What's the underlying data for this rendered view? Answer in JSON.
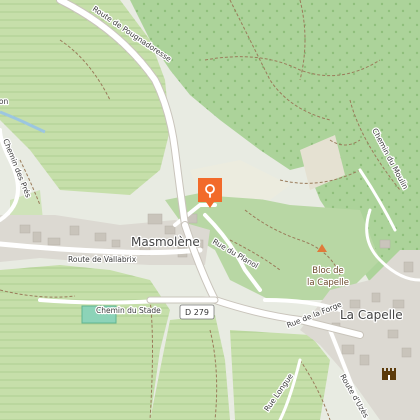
{
  "map": {
    "places": {
      "masmolene": "Masmolène",
      "la_capelle": "La Capelle"
    },
    "roads": {
      "route_pougnadoresse": "Route de Pougnadoresse",
      "route_vallabrix": "Route de Vallabrix",
      "chemin_stade": "Chemin du Stade",
      "rue_planol": "Rue du Planol",
      "rue_forge": "Rue de la Forge",
      "chemin_pres": "Chemin des Prés",
      "chemin_moulin": "Chemin du Moulin",
      "route_uzes": "Route d'Uzès",
      "rue_longue": "Rue Longue",
      "d279": "D 279",
      "partial_label": "ron"
    },
    "poi": {
      "bloc_line1": "Bloc de",
      "bloc_line2": "la Capelle"
    },
    "icons": {
      "marker": "map-pin-marker-icon",
      "peak": "peak-triangle-icon",
      "castle": "castle-icon"
    },
    "colors": {
      "forest": "#b6d8a3",
      "vineyard": "#c9dfb1",
      "marker": "#f26a2a",
      "peak": "#e07a3a",
      "castle": "#5b3a0a"
    }
  }
}
